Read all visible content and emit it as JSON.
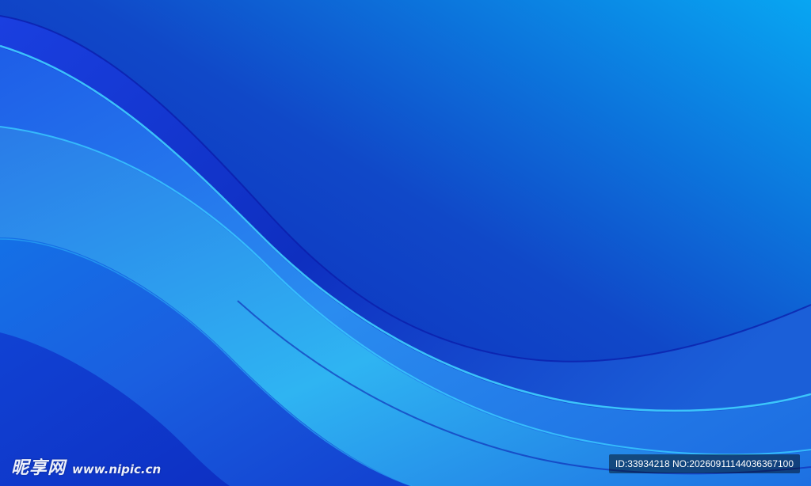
{
  "image": {
    "subject": "abstract blue wave background",
    "colors": {
      "deep_blue": "#0a1fb8",
      "mid_blue": "#1a4fd6",
      "bright_blue": "#1e88f0",
      "cyan": "#22c6f5",
      "sky_blue": "#08a6f2"
    }
  },
  "watermark": {
    "brand": "昵享网",
    "url": "www.nipic.cn",
    "id_text": "ID:33934218 NO:20260911144036367100"
  }
}
